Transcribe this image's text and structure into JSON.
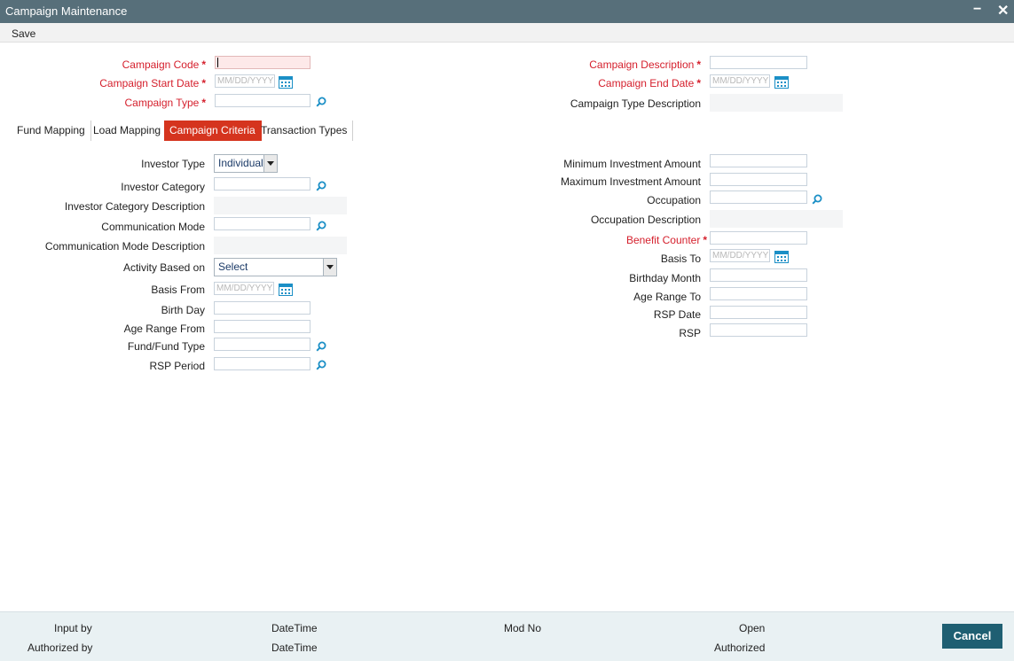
{
  "window": {
    "title": "Campaign Maintenance",
    "minimize": "−",
    "close": "✕"
  },
  "menu": {
    "save_label": "Save"
  },
  "header": {
    "campaign_code_label": "Campaign Code",
    "campaign_start_date_label": "Campaign Start Date",
    "campaign_type_label": "Campaign Type",
    "campaign_description_label": "Campaign Description",
    "campaign_end_date_label": "Campaign End Date",
    "campaign_type_description_label": "Campaign Type Description",
    "required_mark": "*",
    "date_placeholder": "MM/DD/YYYY"
  },
  "tabs": [
    {
      "label": "Fund Mapping",
      "active": false
    },
    {
      "label": "Load Mapping",
      "active": false
    },
    {
      "label": "Campaign Criteria",
      "active": true
    },
    {
      "label": "Transaction Types",
      "active": false
    }
  ],
  "criteria": {
    "left": {
      "investor_type_label": "Investor Type",
      "investor_type_value": "Individual",
      "investor_category_label": "Investor Category",
      "investor_category_description_label": "Investor Category Description",
      "communication_mode_label": "Communication Mode",
      "communication_mode_description_label": "Communication Mode Description",
      "activity_based_on_label": "Activity Based on",
      "activity_based_on_value": "Select",
      "basis_from_label": "Basis From",
      "birth_day_label": "Birth Day",
      "age_range_from_label": "Age Range From",
      "fund_type_label": "Fund/Fund Type",
      "rsp_period_label": "RSP Period"
    },
    "right": {
      "min_investment_label": "Minimum Investment Amount",
      "max_investment_label": "Maximum Investment Amount",
      "occupation_label": "Occupation",
      "occupation_description_label": "Occupation Description",
      "benefit_counter_label": "Benefit Counter",
      "basis_to_label": "Basis To",
      "birthday_month_label": "Birthday Month",
      "age_range_to_label": "Age Range To",
      "rsp_date_label": "RSP Date",
      "rsp_label": "RSP"
    }
  },
  "footer": {
    "input_by": "Input by",
    "authorized_by": "Authorized by",
    "datetime_1": "DateTime",
    "datetime_2": "DateTime",
    "mod_no": "Mod No",
    "open": "Open",
    "authorized": "Authorized",
    "cancel_label": "Cancel"
  },
  "colors": {
    "title_bar": "#576f7a",
    "required_text": "#d5202d",
    "active_tab": "#d5341e",
    "footer_bg": "#e9f1f3",
    "cancel_button": "#1f5f72",
    "icon_blue": "#1b8fc6"
  }
}
